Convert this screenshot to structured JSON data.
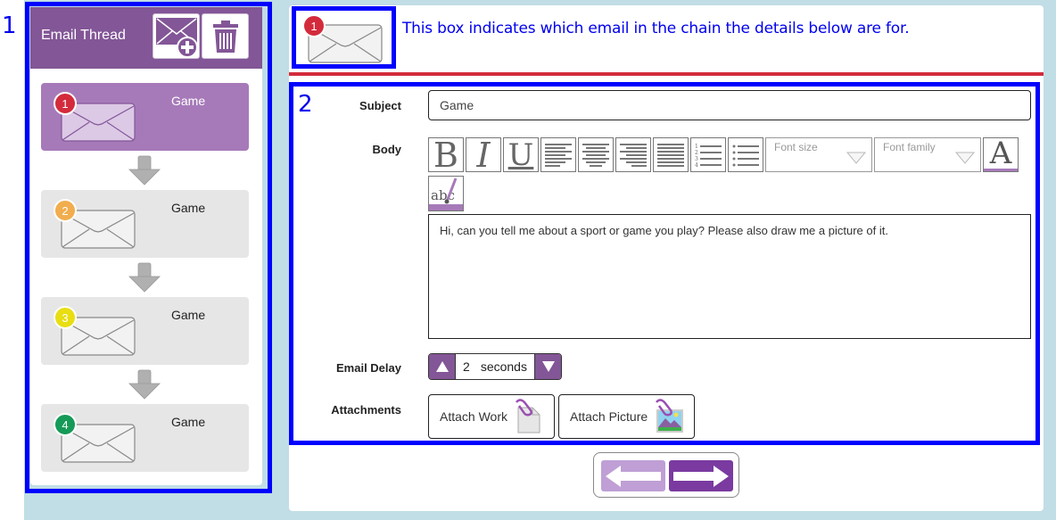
{
  "annotations": {
    "callout_1": "1",
    "callout_2": "2",
    "indicator_text": "This box indicates which email in the chain the details below are for."
  },
  "thread": {
    "title": "Email Thread",
    "add_email_icon": "envelope-plus-icon",
    "delete_icon": "trash-icon",
    "emails": [
      {
        "number": "1",
        "subject": "Game",
        "badge_color": "#d32b3c",
        "active": true
      },
      {
        "number": "2",
        "subject": "Game",
        "badge_color": "#f1ad4e",
        "active": false
      },
      {
        "number": "3",
        "subject": "Game",
        "badge_color": "#e8de12",
        "active": false
      },
      {
        "number": "4",
        "subject": "Game",
        "badge_color": "#169a57",
        "active": false
      }
    ]
  },
  "indicator": {
    "number": "1",
    "badge_color": "#d32b3c"
  },
  "form": {
    "subject_label": "Subject",
    "subject_value": "Game",
    "body_label": "Body",
    "toolbar": {
      "bold": "B",
      "italic": "I",
      "underline": "U",
      "align_left": "align-left-icon",
      "align_center": "align-center-icon",
      "align_right": "align-right-icon",
      "justify": "justify-icon",
      "ordered_list": "ordered-list-icon",
      "unordered_list": "unordered-list-icon",
      "font_size_placeholder": "Font size",
      "font_family_placeholder": "Font family",
      "font_color": "A",
      "spellcheck": "abc"
    },
    "body_value": "Hi, can you tell me about a sport or game you play? Please also draw me a picture of it.",
    "delay_label": "Email Delay",
    "delay_value": "2",
    "delay_unit": "seconds",
    "attachments_label": "Attachments",
    "attach_work": "Attach Work",
    "attach_picture": "Attach Picture"
  },
  "navigation": {
    "prev": "arrow-left-icon",
    "next": "arrow-right-icon"
  },
  "colors": {
    "accent_purple": "#835697",
    "active_card": "#a67ab9",
    "annotation_blue": "#0000ff",
    "rule_red": "#d32b3c",
    "background": "#c1dde6"
  }
}
